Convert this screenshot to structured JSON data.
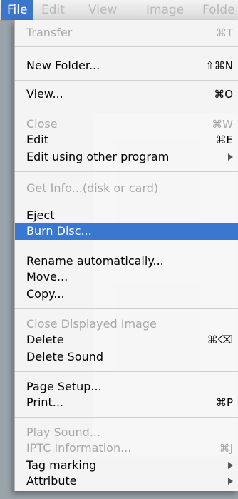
{
  "menubar": {
    "items": [
      {
        "label": "File"
      },
      {
        "label": "Edit"
      },
      {
        "label": "View"
      },
      {
        "label": "Image"
      },
      {
        "label": "Folde"
      }
    ]
  },
  "file_menu": {
    "items": [
      {
        "label": "Transfer",
        "shortcut": "⌘T",
        "enabled": false
      },
      {
        "label": "New Folder...",
        "shortcut": "⇧⌘N",
        "enabled": true
      },
      {
        "label": "View...",
        "shortcut": "⌘O",
        "enabled": true
      },
      {
        "label": "Close",
        "shortcut": "⌘W",
        "enabled": false
      },
      {
        "label": "Edit",
        "shortcut": "⌘E",
        "enabled": true
      },
      {
        "label": "Edit using other program",
        "submenu": true,
        "enabled": true
      },
      {
        "label": "Get Info...(disk or card)",
        "enabled": false
      },
      {
        "label": "Eject",
        "enabled": true
      },
      {
        "label": "Burn Disc...",
        "enabled": true,
        "highlighted": true
      },
      {
        "label": "Rename automatically...",
        "enabled": true
      },
      {
        "label": "Move...",
        "enabled": true
      },
      {
        "label": "Copy...",
        "enabled": true
      },
      {
        "label": "Close Displayed Image",
        "enabled": false
      },
      {
        "label": "Delete",
        "shortcut": "⌘⌫",
        "enabled": true
      },
      {
        "label": "Delete Sound",
        "enabled": true
      },
      {
        "label": "Page Setup...",
        "enabled": true
      },
      {
        "label": "Print...",
        "shortcut": "⌘P",
        "enabled": true
      },
      {
        "label": "Play Sound...",
        "enabled": false
      },
      {
        "label": "IPTC Information...",
        "shortcut": "⌘J",
        "enabled": false
      },
      {
        "label": "Tag marking",
        "submenu": true,
        "enabled": true
      },
      {
        "label": "Attribute",
        "submenu": true,
        "enabled": true
      }
    ]
  },
  "colors": {
    "highlight": "#3a77cf",
    "disabled_text": "#a8a8a8"
  }
}
